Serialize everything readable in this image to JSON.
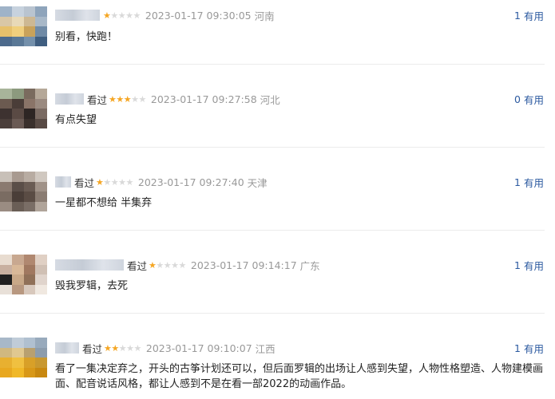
{
  "vote_label": "有用",
  "watched_label": "看过",
  "comments": [
    {
      "rating": 1,
      "time": "2023-01-17 09:30:05",
      "location": "河南",
      "votes": "1",
      "content": "别看，快跑！",
      "watched": false
    },
    {
      "rating": 3,
      "time": "2023-01-17 09:27:58",
      "location": "河北",
      "votes": "0",
      "content": "有点失望",
      "watched": true
    },
    {
      "rating": 1,
      "time": "2023-01-17 09:27:40",
      "location": "天津",
      "votes": "1",
      "content": "一星都不想给 半集弃",
      "watched": true
    },
    {
      "rating": 1,
      "time": "2023-01-17 09:14:17",
      "location": "广东",
      "votes": "1",
      "content": "毁我罗辑，去死",
      "watched": true
    },
    {
      "rating": 2,
      "time": "2023-01-17 09:10:07",
      "location": "江西",
      "votes": "1",
      "content": "看了一集决定弃之，开头的古筝计划还可以，但后面罗辑的出场让人感到失望，人物性格塑造、人物建模画面、配音说话风格，都让人感到不是在看一部2022的动画作品。",
      "watched": true
    }
  ],
  "colors": {
    "star_on": "#f5a623",
    "star_off": "#d9d9d9",
    "link": "#2c5aa0",
    "meta_text": "#999999"
  }
}
